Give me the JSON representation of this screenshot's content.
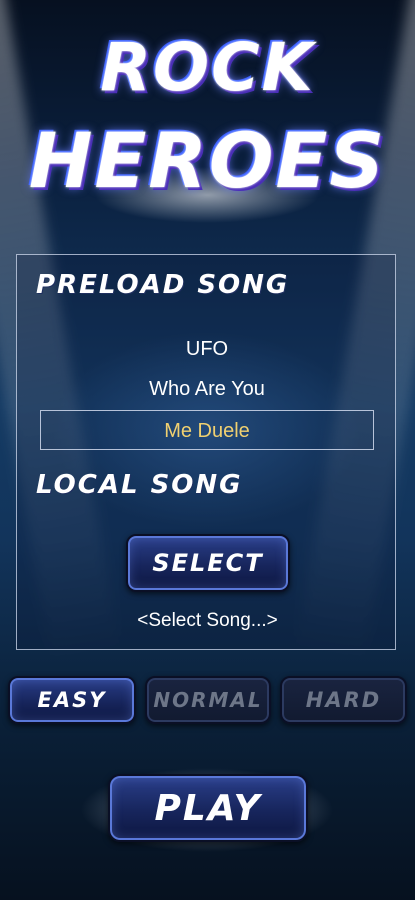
{
  "title": {
    "line1": "ROCK",
    "line2": "HEROES"
  },
  "preload": {
    "label": "PRELOAD SONG",
    "songs": [
      "UFO",
      "Who Are You",
      "Me Duele"
    ],
    "selected": "Me Duele"
  },
  "local": {
    "label": "LOCAL SONG",
    "select_label": "SELECT",
    "hint": "<Select Song...>"
  },
  "difficulty": {
    "easy": "EASY",
    "normal": "NORMAL",
    "hard": "HARD",
    "selected": "EASY"
  },
  "play_label": "PLAY",
  "colors": {
    "selected_song": "#f0d070",
    "button_face": "#17255c",
    "disabled_text": "#6d7688"
  }
}
